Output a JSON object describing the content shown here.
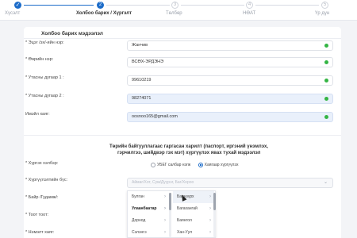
{
  "stepper": {
    "steps": [
      {
        "label": "Хүсэлт",
        "marker": "✓",
        "state": "done"
      },
      {
        "label": "Холбоо барих / Хүргэлт",
        "marker": "2",
        "state": "active"
      },
      {
        "label": "Төлбөр",
        "marker": "3",
        "state": "todo"
      },
      {
        "label": "НӨАТ",
        "marker": "4",
        "state": "todo"
      },
      {
        "label": "Үр дүн",
        "marker": "5",
        "state": "todo"
      }
    ]
  },
  "contact": {
    "title": "Холбоо барих мэдээлэл",
    "fields": [
      {
        "label": "* Эцэг /эх/-ийн нэр:",
        "value": "Жанчив",
        "filled": false,
        "valid": true
      },
      {
        "label": "* Өөрийн нэр:",
        "value": "ВСӨХ-ЭРДЭНЭ",
        "filled": false,
        "valid": true
      },
      {
        "label": "* Утасны дугаар 1 :",
        "value": "99610219",
        "filled": false,
        "valid": true
      },
      {
        "label": "* Утасны дугаар 2 :",
        "value": "98274071",
        "filled": true,
        "valid": true
      },
      {
        "label": "Имэйл хаяг:",
        "value": "oosnoo165@gmail.com",
        "filled": true,
        "valid": true
      }
    ]
  },
  "delivery": {
    "title_line1": "Төрийн байгууллагаас гаргасан харилт (паспорт, иргэний үнэмлэх,",
    "title_line2": "гэрчилгээ, шийдвэр гэх мэт) хүргүүлэх явах тухай мэдээлэл",
    "method_label": "* Хүргэх хэлбэр:",
    "option_pickup": "УБЕГ салбар нэгж",
    "option_delivery": "Хаягаар хүргүүлэх",
    "selected_option": "Хаягаар хүргүүлэх",
    "area_label": "* Хүргүүлэлтийн бүс:",
    "area_placeholder": "Аймаг/Хот, Сум/Дүүрэг, Баг/Хороо",
    "building_label": "* Байр /Гудамж/:",
    "door_label": "* Тоот тоот:",
    "extra_label": "* Нэмэлт хаяг:"
  },
  "dropdown": {
    "col1": [
      {
        "label": "Булган",
        "bold": false
      },
      {
        "label": "Улаанбаатар",
        "bold": true
      },
      {
        "label": "Дорнод",
        "bold": false
      },
      {
        "label": "Сэлэнгэ",
        "bold": false
      }
    ],
    "col2": [
      {
        "label": "Баянзүрх",
        "hover": true
      },
      {
        "label": "Багахангай",
        "hover": false
      },
      {
        "label": "Баянгол",
        "hover": false
      },
      {
        "label": "Хан-Уул",
        "hover": false
      }
    ]
  }
}
